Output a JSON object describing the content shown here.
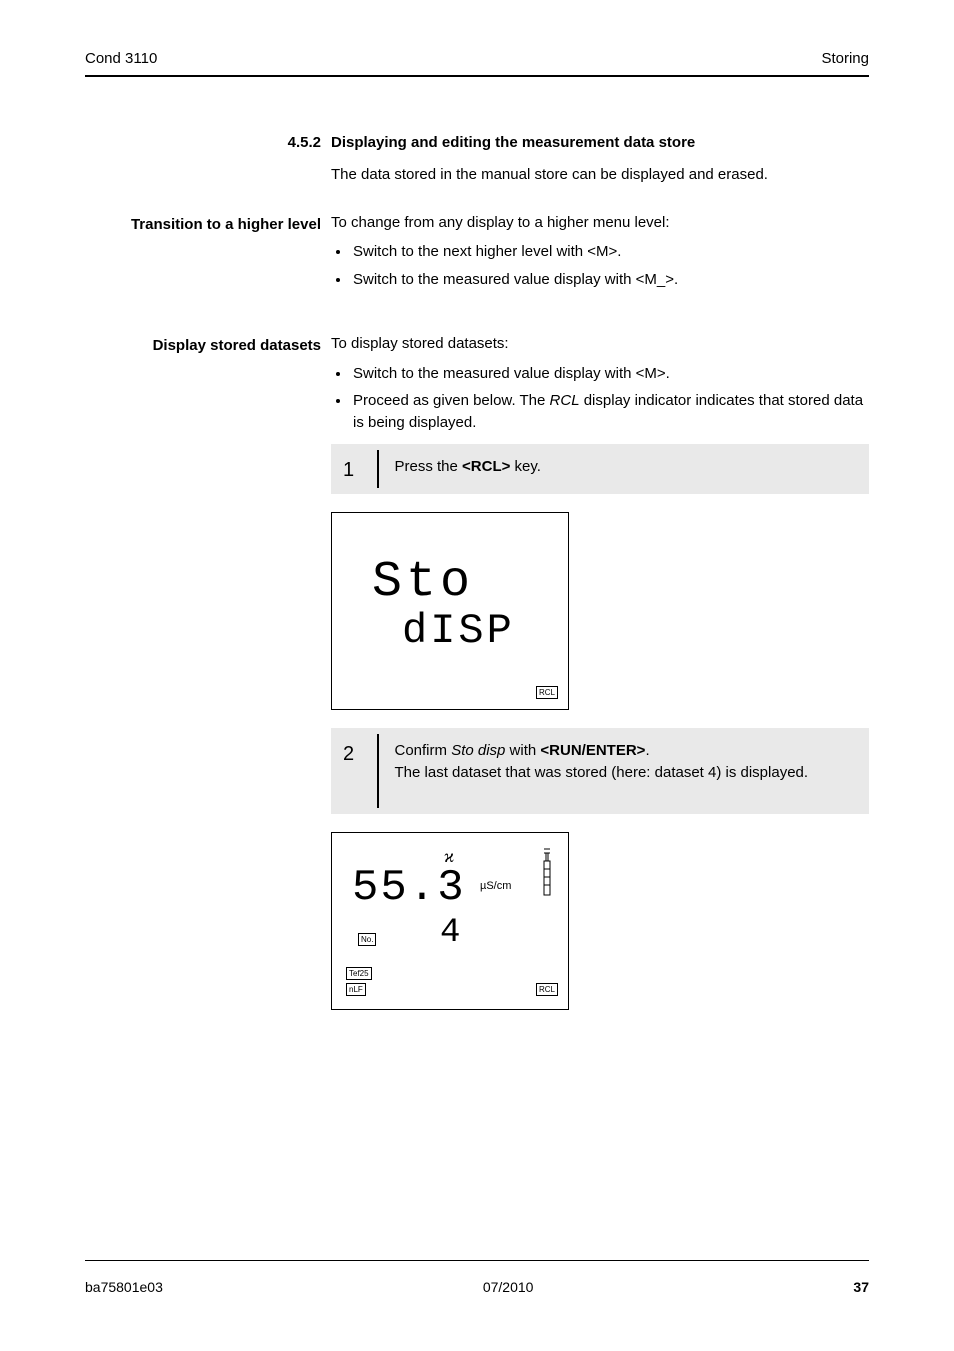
{
  "header": {
    "left": "Cond 3110",
    "right": "Storing"
  },
  "section": {
    "heading_num": "4.5.2",
    "heading_text": "Displaying and editing the measurement data store",
    "intro": "The data stored in the manual store can be displayed and erased."
  },
  "transitions": {
    "label": "Transition to a higher level",
    "intro": "To change from any display to a higher menu level:",
    "items": [
      "Switch to the next higher level with <M>.",
      "Switch to the measured value display with <M_>."
    ]
  },
  "display_stored": {
    "label": "Display stored datasets",
    "intro": "To display stored datasets:",
    "bullet1": "Switch to the measured value display with <M>.",
    "bullet2_prefix": "Proceed as given below. The ",
    "bullet2_rcl": "RCL",
    "bullet2_suffix": " display indicator indicates that stored data is being displayed."
  },
  "step1": {
    "num": "1",
    "text_a": "Press the ",
    "key": "<RCL>",
    "text_b": " key."
  },
  "step2": {
    "num": "2",
    "text_a": "Confirm ",
    "ital": "Sto disp",
    "text_b": " with ",
    "key1": "<RUN/ENTER>",
    "text_c": ".",
    "text_d": "The last dataset that was stored (here: dataset 4) is displayed."
  },
  "lcd1": {
    "line1": "Sto",
    "line2": "dISP",
    "rcl": "RCL"
  },
  "lcd2": {
    "chi": "ϰ",
    "value": "55.3",
    "unit": "µS/cm",
    "number": "4",
    "no_tag": "No.",
    "tef": "Tef25",
    "nlf": "nLF",
    "rcl": "RCL"
  },
  "footer": {
    "left": "ba75801e03",
    "center": "07/2010",
    "right": "37"
  }
}
